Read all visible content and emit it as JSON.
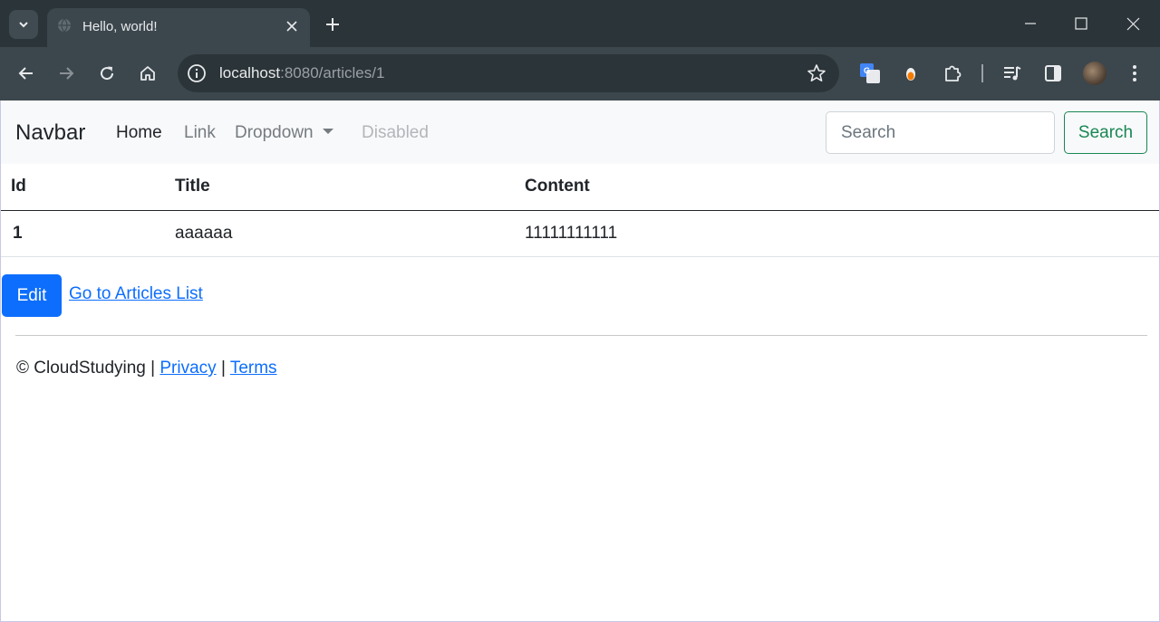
{
  "browser": {
    "tab_title": "Hello, world!",
    "url_host": "localhost",
    "url_rest": ":8080/articles/1"
  },
  "navbar": {
    "brand": "Navbar",
    "links": [
      {
        "label": "Home",
        "state": "active"
      },
      {
        "label": "Link",
        "state": "normal"
      },
      {
        "label": "Dropdown",
        "state": "dropdown"
      },
      {
        "label": "Disabled",
        "state": "disabled"
      }
    ],
    "search_placeholder": "Search",
    "search_button": "Search"
  },
  "table": {
    "headers": [
      "Id",
      "Title",
      "Content"
    ],
    "rows": [
      {
        "id": "1",
        "title": "aaaaaa",
        "content": "11111111111"
      }
    ]
  },
  "actions": {
    "edit_label": "Edit",
    "list_link_label": "Go to Articles List"
  },
  "footer": {
    "copyright": "© CloudStudying |",
    "separator": "|",
    "privacy": "Privacy",
    "terms": "Terms"
  },
  "colors": {
    "primary": "#0d6efd",
    "success": "#198754",
    "navbar_bg": "#f8f9fa",
    "chrome_dark": "#2b3438",
    "chrome_toolbar": "#3c474d"
  },
  "icons": {
    "tab_search": "chevron-down-icon",
    "favicon": "globe-icon",
    "tab_close": "close-icon",
    "new_tab": "plus-icon",
    "back": "arrow-left-icon",
    "forward": "arrow-right-icon",
    "reload": "reload-icon",
    "home": "home-icon",
    "site_info": "info-icon",
    "bookmark": "star-icon",
    "translate": "translate-icon",
    "extensions": "puzzle-icon",
    "media": "media-icon",
    "side_panel": "side-panel-icon",
    "menu": "kebab-menu-icon"
  }
}
